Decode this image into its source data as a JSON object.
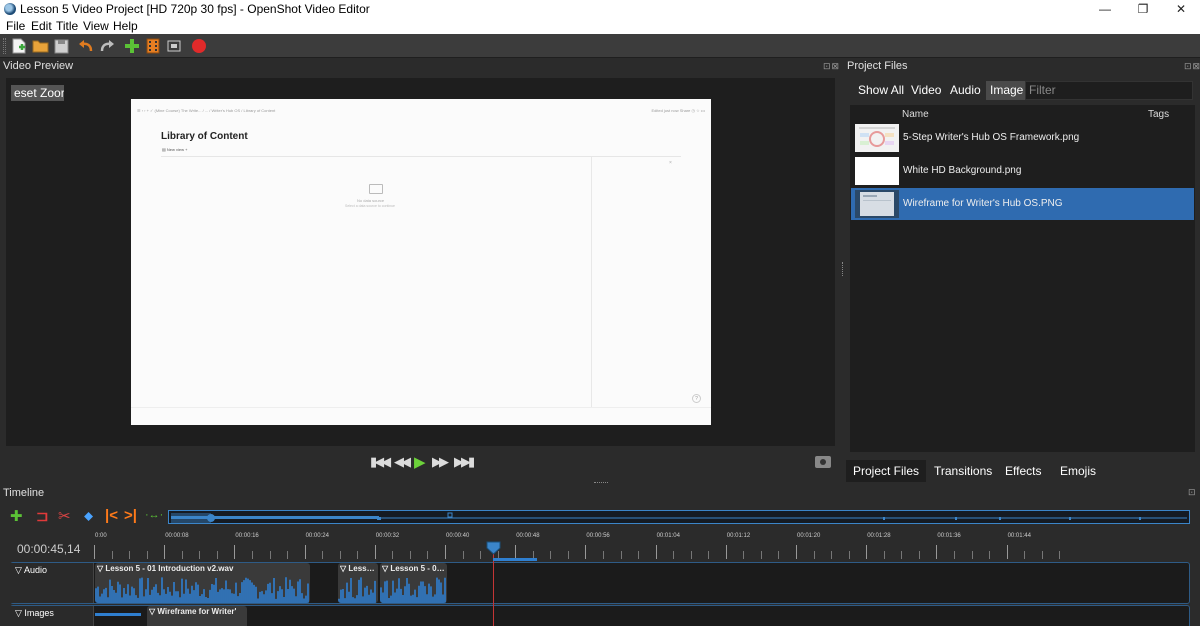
{
  "window": {
    "title": "Lesson 5 Video Project [HD 720p 30 fps] - OpenShot Video Editor",
    "minimize": "—",
    "maximize": "❐",
    "close": "✕"
  },
  "menu": [
    "File",
    "Edit",
    "Title",
    "View",
    "Help"
  ],
  "toolbar": {
    "icons": [
      "new-project-icon",
      "open-project-icon",
      "save-project-icon",
      "undo-icon",
      "redo-icon",
      "import-files-icon",
      "choose-profile-icon",
      "fullscreen-icon",
      "export-video-icon"
    ]
  },
  "video_preview": {
    "title": "Video Preview",
    "reset_zoom": "eset Zoor",
    "frame": {
      "breadcrumbs": "☰  ‹  ›  +  ✓  (Mine Course) The Write... / ... / Writer's Hub OS / Library of Content",
      "right_bits": "Edited just now   Share   ◷  ☆  •••",
      "heading": "Library of Content",
      "view_label": "▤ New view  +",
      "empty_title": "No data source",
      "empty_hint": "Select a data source to continue",
      "close": "×",
      "help": "?"
    }
  },
  "project_files": {
    "title": "Project Files",
    "tabs": [
      {
        "label": "Show All",
        "active": false
      },
      {
        "label": "Video",
        "active": false
      },
      {
        "label": "Audio",
        "active": false
      },
      {
        "label": "Image",
        "active": true
      }
    ],
    "filter_placeholder": "Filter",
    "col_name": "Name",
    "col_tags": "Tags",
    "files": [
      {
        "name": "5-Step Writer's Hub OS Framework.png",
        "selected": false
      },
      {
        "name": "White HD Background.png",
        "selected": false
      },
      {
        "name": "Wireframe for Writer's Hub OS.PNG",
        "selected": true
      }
    ]
  },
  "bottom_tabs": [
    {
      "label": "Project Files",
      "active": true
    },
    {
      "label": "Transitions",
      "active": false
    },
    {
      "label": "Effects",
      "active": false
    },
    {
      "label": "Emojis",
      "active": false
    }
  ],
  "timeline": {
    "title": "Timeline",
    "timecode": "00:00:45,14",
    "ruler_labels": [
      "0:00",
      "00:00:08",
      "00:00:16",
      "00:00:24",
      "00:00:32",
      "00:00:40",
      "00:00:48",
      "00:00:56",
      "00:01:04",
      "00:01:12",
      "00:01:20",
      "00:01:28",
      "00:01:36",
      "00:01:44"
    ],
    "tracks": [
      {
        "name": "Audio"
      },
      {
        "name": "Images"
      }
    ],
    "clips": {
      "audio_1": "Lesson 5 - 01 Introduction v2.wav",
      "audio_2": "Lesso...",
      "audio_3": "Lesson 5 - 01 ...",
      "image_1": "Wireframe for Writer'"
    }
  },
  "colors": {
    "accent": "#2f6bb0",
    "playhead": "#c43535",
    "waveform": "#2f7fd0",
    "bg": "#2b2b2b"
  }
}
